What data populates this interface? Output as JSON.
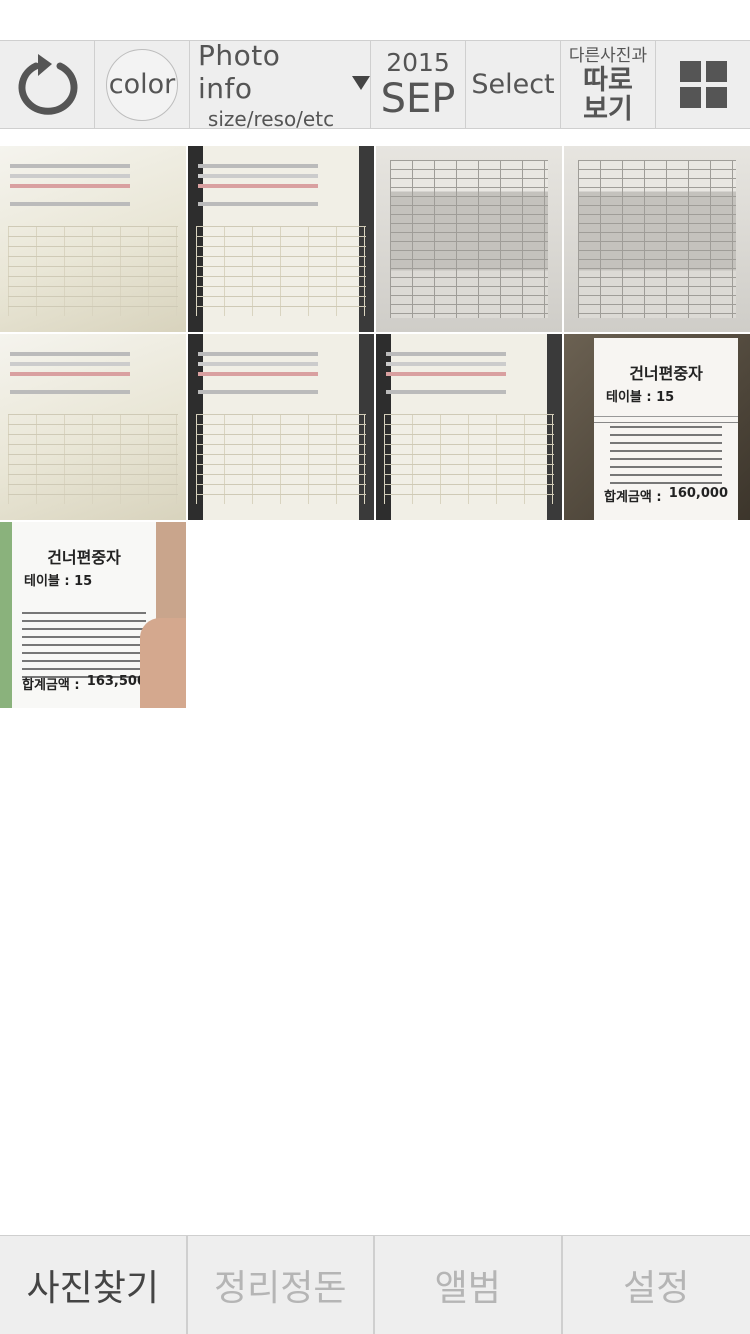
{
  "toolbar": {
    "back_icon": "refresh-back-icon",
    "color_label": "color",
    "info_title": "Photo info",
    "info_sub": "size/reso/etc",
    "date_year": "2015",
    "date_month": "SEP",
    "select_label": "Select",
    "other_small": "다른사진과",
    "other_big_1": "따로",
    "other_big_2": "보기",
    "grid_icon": "grid-view-icon"
  },
  "photos": [
    {
      "kind": "web-screenshot",
      "title": "",
      "table": "",
      "total": ""
    },
    {
      "kind": "monitor-screen",
      "title": "",
      "table": "",
      "total": ""
    },
    {
      "kind": "printed-table",
      "title": "",
      "table": "",
      "total": ""
    },
    {
      "kind": "printed-table",
      "title": "",
      "table": "",
      "total": ""
    },
    {
      "kind": "monitor-screen",
      "title": "",
      "table": "",
      "total": ""
    },
    {
      "kind": "monitor-screen",
      "title": "",
      "table": "",
      "total": ""
    },
    {
      "kind": "monitor-screen",
      "title": "",
      "table": "",
      "total": ""
    },
    {
      "kind": "receipt",
      "title": "건너편중자",
      "table": "테이블 : 15",
      "total_label": "합계금액 :",
      "total": "160,000"
    },
    {
      "kind": "receipt",
      "title": "건너편중자",
      "table": "테이블 : 15",
      "total_label": "합계금액 :",
      "total": "163,500"
    }
  ],
  "tabs": [
    {
      "label": "사진찾기",
      "active": true
    },
    {
      "label": "정리정돈",
      "active": false
    },
    {
      "label": "앨범",
      "active": false
    },
    {
      "label": "설정",
      "active": false
    }
  ]
}
